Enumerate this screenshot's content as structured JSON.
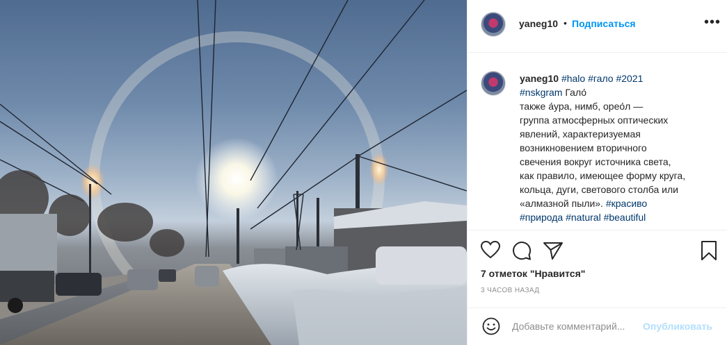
{
  "post": {
    "username": "yaneg10",
    "dot": "•",
    "follow_label": "Подписаться",
    "more_label": "•••",
    "caption": {
      "username": "yaneg10",
      "tag1": "#halo",
      "tag2": "#гало",
      "tag3": "#2021",
      "tag4": "#nskgram",
      "word": "Гало́",
      "line1": "также а́ура, нимб, орео́л —",
      "line2": "группа атмосферных оптических",
      "line3": "явлений, характеризуемая",
      "line4": "возникновением вторичного",
      "line5": "свечения вокруг источника света,",
      "line6": "как правило, имеющее форму круга,",
      "line7": "кольца, дуги, светового столба или",
      "line8": "«алмазной пыли».",
      "tag5": "#красиво",
      "tag6": "#природа",
      "tag7": "#natural",
      "tag8": "#beautiful"
    },
    "likes": "7 отметок \"Нравится\"",
    "time_ago": "3 часов назад",
    "comment_placeholder": "Добавьте комментарий...",
    "publish_label": "Опубликовать"
  },
  "icons": {
    "like": "heart-icon",
    "comment": "comment-icon",
    "share": "share-icon",
    "save": "bookmark-icon",
    "emoji": "emoji-icon"
  },
  "colors": {
    "link_blue": "#0095f6",
    "tag_blue": "#00376b",
    "muted": "#8e8e8e",
    "publish_disabled": "#b2dffc"
  }
}
